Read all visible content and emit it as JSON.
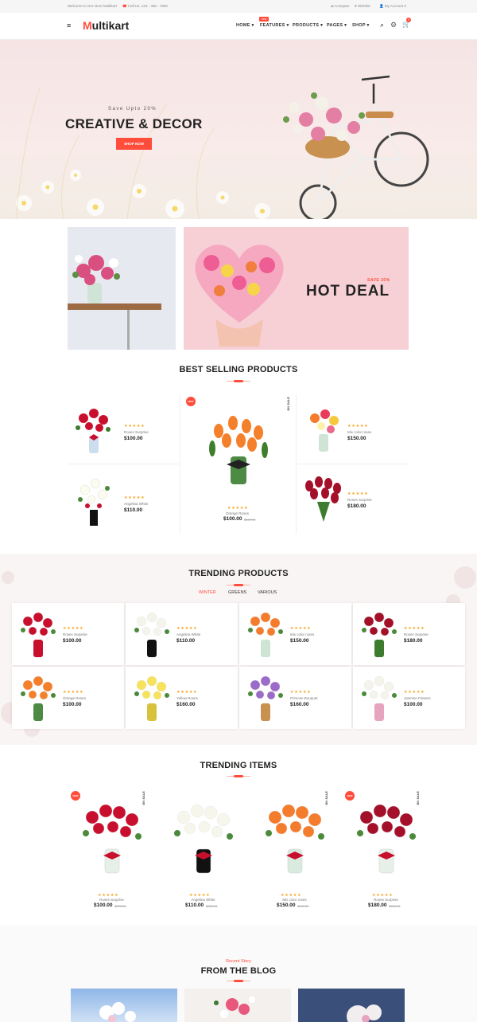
{
  "topbar": {
    "welcome": "Welcome to Our store Multikart",
    "call": "Call Us: 123 - 456 - 7890",
    "compare": "Compare",
    "wishlist": "Wishlist",
    "account": "My Account"
  },
  "header": {
    "logo_initial": "M",
    "logo_rest": "ultikart",
    "nav": [
      "HOME",
      "FEATURES",
      "PRODUCTS",
      "PAGES",
      "SHOP"
    ],
    "features_badge": "new",
    "cart_count": "0"
  },
  "hero": {
    "subtitle": "Save Upto 20%",
    "title": "CREATIVE & DECOR",
    "button": "SHOP NOW"
  },
  "banner": {
    "save": "SAVE 30%",
    "title": "HOT DEAL"
  },
  "best": {
    "title": "BEST SELLING PRODUCTS",
    "stars": "★★★★★",
    "left": [
      {
        "name": "Roses Surprise",
        "price": "$100.00"
      },
      {
        "name": "Angelina White",
        "price": "$110.00"
      }
    ],
    "right": [
      {
        "name": "Mix color roses",
        "price": "$150.00"
      },
      {
        "name": "Roses Surprise",
        "price": "$180.00"
      }
    ],
    "center": {
      "name": "Orange Roses",
      "price": "$100.00",
      "old": "$200.00",
      "new": "NEW",
      "onsale": "ON SALE"
    }
  },
  "trending": {
    "title": "TRENDING PRODUCTS",
    "tabs": [
      "WINTER",
      "GREENS",
      "VARIOUS"
    ],
    "stars": "★★★★★",
    "items": [
      {
        "name": "Roses Surprise",
        "price": "$100.00"
      },
      {
        "name": "Angelina White",
        "price": "$110.00"
      },
      {
        "name": "Mix color roses",
        "price": "$150.00"
      },
      {
        "name": "Roses Surprise",
        "price": "$180.00"
      },
      {
        "name": "Orange Roses",
        "price": "$100.00"
      },
      {
        "name": "Yellow Roses",
        "price": "$160.00"
      },
      {
        "name": "Primose Bouquet",
        "price": "$160.00"
      },
      {
        "name": "Jasmine Flowers",
        "price": "$100.00"
      }
    ]
  },
  "items": {
    "title": "TRENDING ITEMS",
    "stars": "★★★★★",
    "new": "NEW",
    "onsale": "ON SALE",
    "list": [
      {
        "name": "Roses Surprise",
        "price": "$100.00",
        "old": "$200.00"
      },
      {
        "name": "Angelina White",
        "price": "$110.00",
        "old": "$220.00"
      },
      {
        "name": "Mix color roses",
        "price": "$150.00",
        "old": "$300.00"
      },
      {
        "name": "Roses Surprise",
        "price": "$180.00",
        "old": "$360.00"
      }
    ]
  },
  "blog": {
    "subtitle": "Recent Story",
    "title": "FROM THE BLOG"
  },
  "colors": {
    "accent": "#ff4c3b",
    "star": "#f7a21b"
  }
}
